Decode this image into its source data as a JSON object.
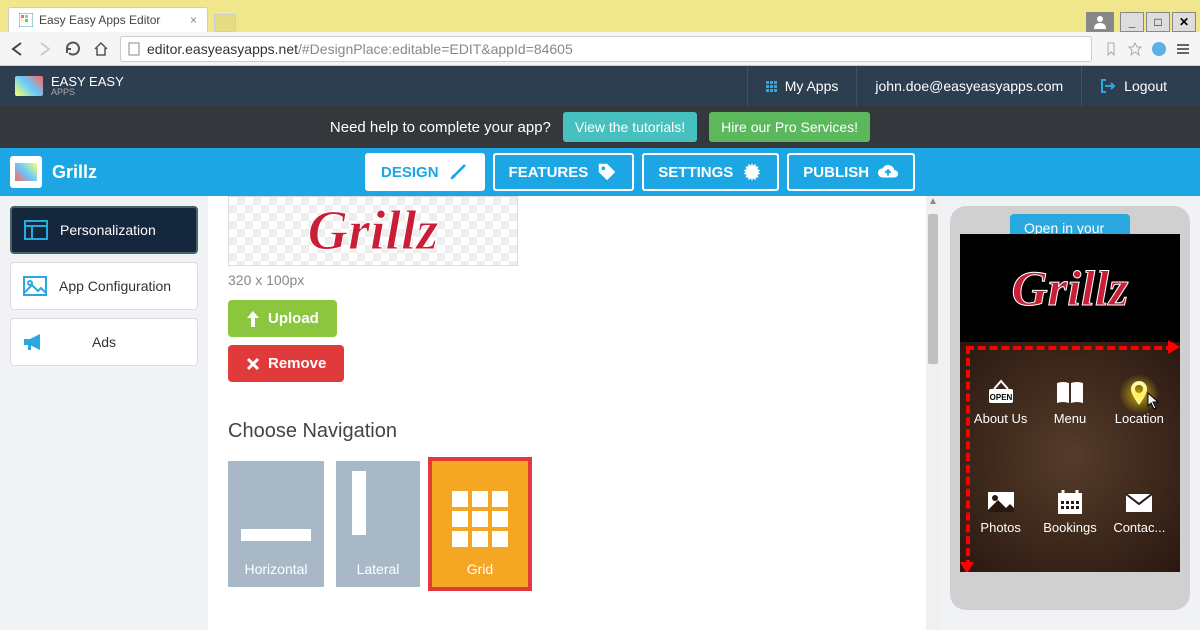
{
  "browser": {
    "tab_title": "Easy Easy Apps Editor",
    "url_host": "editor.easyeasyapps.net",
    "url_path": "/#DesignPlace:editable=EDIT&appId=84605"
  },
  "header": {
    "brand_line1": "EASY EASY",
    "brand_line2": "APPS",
    "my_apps": "My Apps",
    "user_email": "john.doe@easyeasyapps.com",
    "logout": "Logout"
  },
  "help_bar": {
    "prompt": "Need help to complete your app?",
    "tutorials_btn": "View the tutorials!",
    "pro_btn": "Hire our Pro Services!"
  },
  "blue_nav": {
    "app_name": "Grillz",
    "tabs": {
      "design": "DESIGN",
      "features": "FEATURES",
      "settings": "SETTINGS",
      "publish": "PUBLISH"
    }
  },
  "sidebar": {
    "personalization": "Personalization",
    "app_config": "App Configuration",
    "ads": "Ads"
  },
  "content": {
    "logo_text": "Grillz",
    "dimensions": "320 x 100px",
    "upload": "Upload",
    "remove": "Remove",
    "choose_nav_title": "Choose Navigation",
    "nav_options": {
      "horizontal": "Horizontal",
      "lateral": "Lateral",
      "grid": "Grid"
    }
  },
  "phone": {
    "open_btn": "Open in your phone",
    "logo_text": "Grillz",
    "items": {
      "about": "About Us",
      "menu": "Menu",
      "location": "Location",
      "photos": "Photos",
      "bookings": "Bookings",
      "contact": "Contac..."
    },
    "open_sign": "OPEN"
  }
}
